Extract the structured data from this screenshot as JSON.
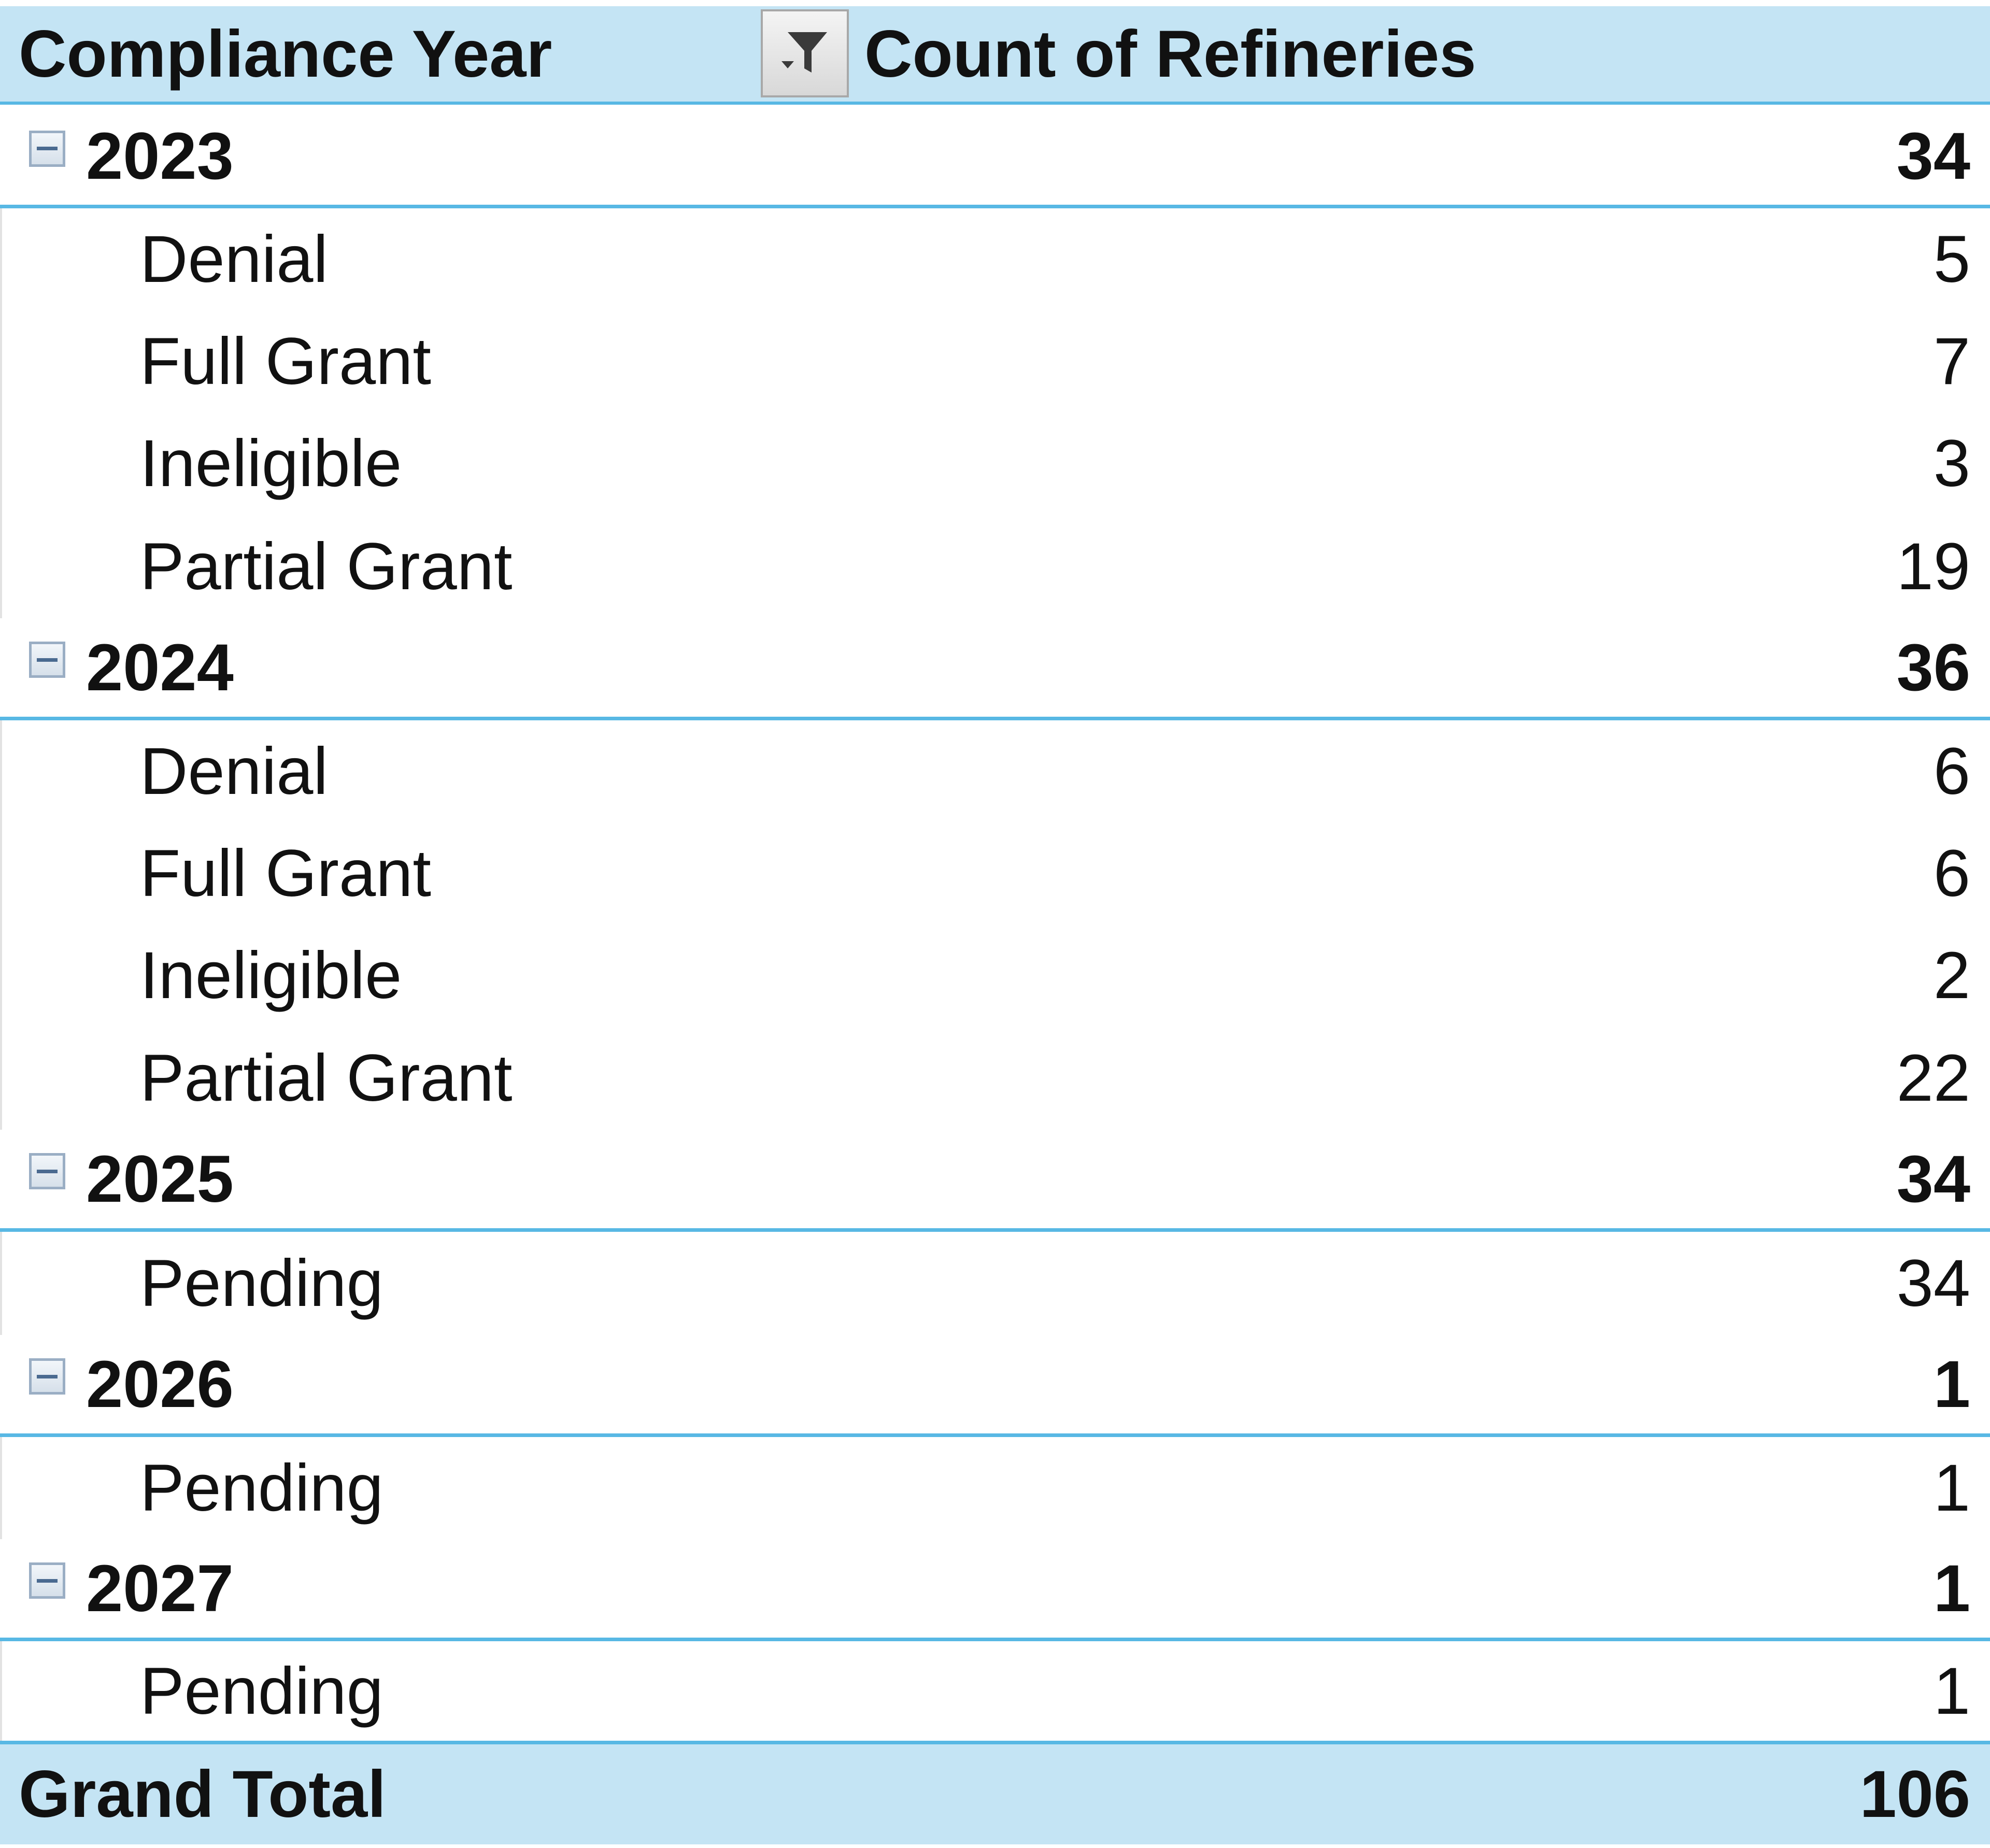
{
  "header": {
    "row_label": "Compliance Year",
    "value_label": "Count of Refineries",
    "filter_icon": "filter-dropdown-icon"
  },
  "rows": [
    {
      "type": "year",
      "label": "2023",
      "value": "34"
    },
    {
      "type": "detail",
      "label": "Denial",
      "value": "5"
    },
    {
      "type": "detail",
      "label": "Full Grant",
      "value": "7"
    },
    {
      "type": "detail",
      "label": "Ineligible",
      "value": "3"
    },
    {
      "type": "detail",
      "label": "Partial Grant",
      "value": "19"
    },
    {
      "type": "year",
      "label": "2024",
      "value": "36"
    },
    {
      "type": "detail",
      "label": "Denial",
      "value": "6"
    },
    {
      "type": "detail",
      "label": "Full Grant",
      "value": "6"
    },
    {
      "type": "detail",
      "label": "Ineligible",
      "value": "2"
    },
    {
      "type": "detail",
      "label": "Partial Grant",
      "value": "22"
    },
    {
      "type": "year",
      "label": "2025",
      "value": "34"
    },
    {
      "type": "detail",
      "label": "Pending",
      "value": "34"
    },
    {
      "type": "year",
      "label": "2026",
      "value": "1"
    },
    {
      "type": "detail",
      "label": "Pending",
      "value": "1"
    },
    {
      "type": "year",
      "label": "2027",
      "value": "1"
    },
    {
      "type": "detail",
      "label": "Pending",
      "value": "1"
    }
  ],
  "grand_total": {
    "label": "Grand Total",
    "value": "106"
  },
  "colors": {
    "header_fill": "#c4e4f4",
    "accent_line": "#58b8e4"
  }
}
